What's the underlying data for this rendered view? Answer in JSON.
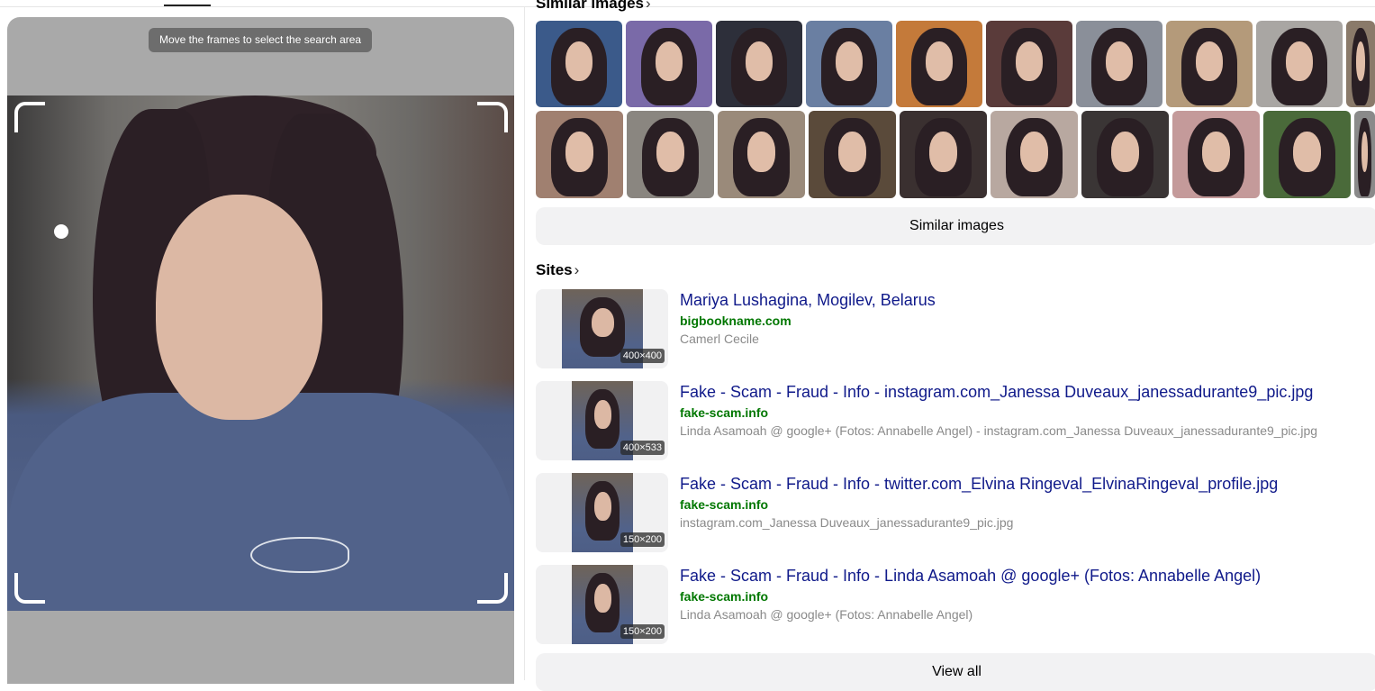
{
  "crop_panel": {
    "hint": "Move the frames to select the search area"
  },
  "similar": {
    "title": "Similar images",
    "title_chevron": "›",
    "row1_colors": [
      "#3b5a8a",
      "#7a6aa8",
      "#2d2f3a",
      "#6a7fa2",
      "#c47a3a",
      "#5a3b3a",
      "#8a8f99",
      "#b49a7a",
      "#a9a6a3",
      "#8a7a6a"
    ],
    "row2_colors": [
      "#a08070",
      "#8a8680",
      "#9a8a7a",
      "#5a4a3a",
      "#3a3030",
      "#b8a8a0",
      "#3a3535",
      "#c49a9a",
      "#4a6a3a",
      "#8a8a8a"
    ],
    "button_label": "Similar images"
  },
  "sites": {
    "title": "Sites",
    "chevron": "›",
    "items": [
      {
        "title": "Mariya Lushagina, Mogilev, Belarus",
        "domain": "bigbookname.com",
        "desc": "Camerl Cecile",
        "dim": "400×400"
      },
      {
        "title": "Fake - Scam - Fraud - Info - instagram.com_Janessa Duveaux_janessadurante9_pic.jpg",
        "domain": "fake-scam.info",
        "desc": "Linda Asamoah @ google+ (Fotos: Annabelle Angel) - instagram.com_Janessa Duveaux_janessadurante9_pic.jpg",
        "dim": "400×533"
      },
      {
        "title": "Fake - Scam - Fraud - Info - twitter.com_Elvina Ringeval_ElvinaRingeval_profile.jpg",
        "domain": "fake-scam.info",
        "desc": "instagram.com_Janessa Duveaux_janessadurante9_pic.jpg",
        "dim": "150×200"
      },
      {
        "title": "Fake - Scam - Fraud - Info - Linda Asamoah @ google+ (Fotos: Annabelle Angel)",
        "domain": "fake-scam.info",
        "desc": "Linda Asamoah @ google+ (Fotos: Annabelle Angel)",
        "dim": "150×200"
      }
    ],
    "view_all_label": "View all"
  }
}
